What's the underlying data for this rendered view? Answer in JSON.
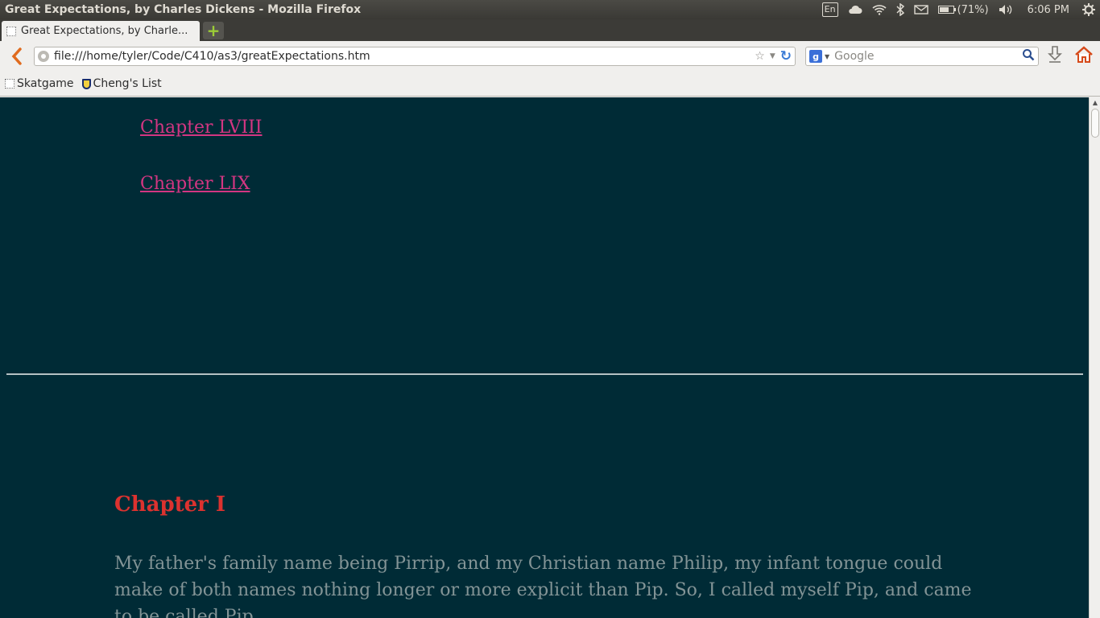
{
  "top_panel": {
    "window_title": "Great Expectations, by Charles Dickens - Mozilla Firefox",
    "keyboard_layout": "En",
    "battery_text": "(71%)",
    "battery_level": 0.71,
    "clock": "6:06 PM"
  },
  "tabs": [
    {
      "label": "Great Expectations, by Charle..."
    }
  ],
  "nav": {
    "url": "file:///home/tyler/Code/C410/as3/greatExpectations.htm",
    "search_placeholder": "Google",
    "search_engine_glyph": "g"
  },
  "bookmarks": [
    {
      "label": "Skatgame",
      "icon": "blank-page-icon"
    },
    {
      "label": "Cheng's List",
      "icon": "shield-icon"
    }
  ],
  "page": {
    "toc_links": [
      "Chapter LVIII",
      "Chapter LIX"
    ],
    "chapter_heading": "Chapter I",
    "chapter_text": "My father's family name being Pirrip, and my Christian name Philip, my infant tongue could make of both names nothing longer or more explicit than Pip. So, I called myself Pip, and came to be called Pip."
  },
  "scroll": {
    "position": 0.0
  },
  "colors": {
    "page_background": "#002b36",
    "link": "#d33682",
    "heading": "#dc322f",
    "body_text": "#839496"
  }
}
